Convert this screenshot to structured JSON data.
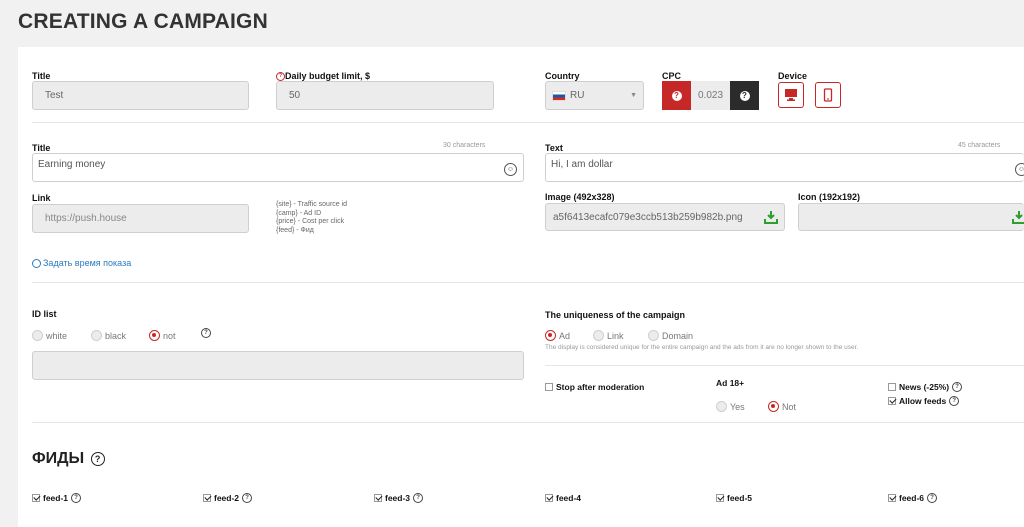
{
  "page": {
    "title": "CREATING A CAMPAIGN"
  },
  "row1": {
    "title_label": "Title",
    "title_value": "Test",
    "budget_label": "Daily budget limit, $",
    "budget_value": "50",
    "country_label": "Country",
    "country_value": "RU",
    "cpc_label": "CPC",
    "cpc_value": "0.023",
    "device_label": "Device"
  },
  "ad": {
    "title_label": "Title",
    "title_counter": "30 characters",
    "title_value": "Earning money",
    "text_label": "Text",
    "text_counter": "45 characters",
    "text_value": "Hi, I am dollar",
    "link_label": "Link",
    "link_placeholder": "https://push.house",
    "macros": [
      "{site} - Traffic source id",
      "{camp} - Ad ID",
      "{price} - Cost per click",
      "{feed} - Фид"
    ],
    "image_label": "Image (492x328)",
    "image_value": "a5f6413ecafc079e3ccb513b259b982b.png",
    "icon_label": "Icon (192x192)",
    "schedule_link": "Задать время показа"
  },
  "idlist": {
    "label": "ID list",
    "options": [
      "white",
      "black",
      "not"
    ],
    "selected": "not"
  },
  "uniqueness": {
    "label": "The uniqueness of the campaign",
    "options": [
      "Ad",
      "Link",
      "Domain"
    ],
    "selected": "Ad",
    "note": "The display is considered unique for the entire campaign and the ads from it are no longer shown to the user."
  },
  "flags": {
    "stop_after_moderation": "Stop after moderation",
    "ad18_label": "Ad 18+",
    "ad18_options": [
      "Yes",
      "Not"
    ],
    "ad18_selected": "Not",
    "news": "News (-25%)",
    "allow_feeds": "Allow feeds"
  },
  "feeds": {
    "heading": "ФИДЫ",
    "items": [
      "feed-1",
      "feed-2",
      "feed-3",
      "feed-4",
      "feed-5",
      "feed-6"
    ]
  },
  "colors": {
    "accent": "#c62828",
    "dark": "#2b2b2b"
  }
}
